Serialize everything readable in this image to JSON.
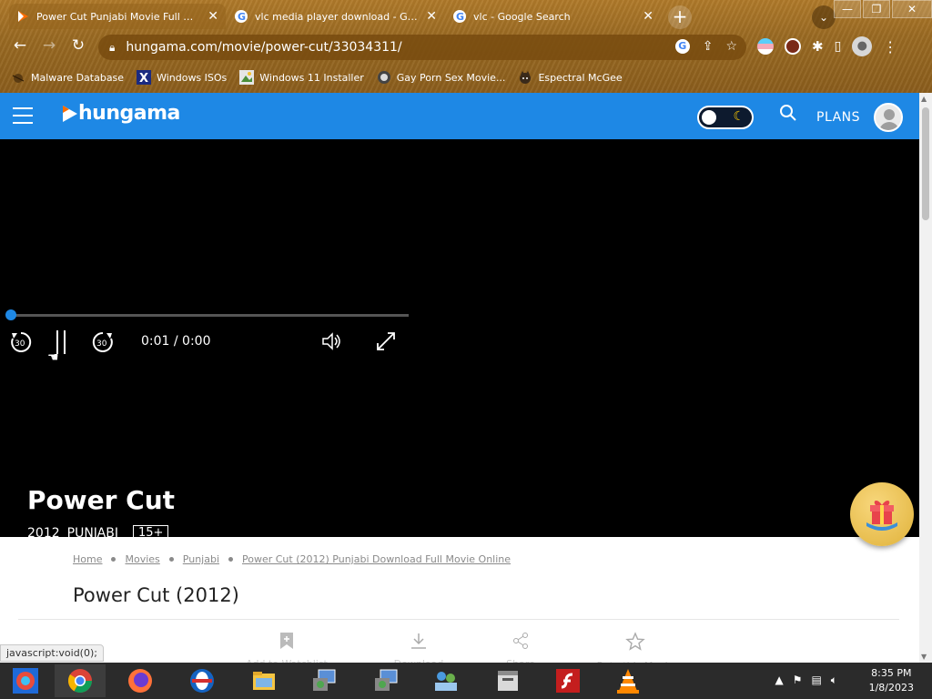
{
  "browser": {
    "tabs": [
      {
        "title": "Power Cut Punjabi Movie Full Download",
        "active": true
      },
      {
        "title": "vlc media player download - Google",
        "active": false
      },
      {
        "title": "vlc - Google Search",
        "active": false
      }
    ],
    "url": "hungama.com/movie/power-cut/33034311/",
    "bookmarks": [
      {
        "label": "Malware Database",
        "icon": "bug-icon"
      },
      {
        "label": "Windows ISOs",
        "icon": "x-logo-icon"
      },
      {
        "label": "Windows 11 Installer",
        "icon": "image-icon"
      },
      {
        "label": "Gay Porn Sex Movie...",
        "icon": "globe-icon"
      },
      {
        "label": "Espectral McGee",
        "icon": "cat-icon"
      }
    ],
    "status_text": "javascript:void(0);"
  },
  "header": {
    "logo_text": "hungama",
    "plans_label": "PLANS",
    "accent": "#1e88e5"
  },
  "player": {
    "time_display": "0:01 / 0:00",
    "skip_back_label": "30",
    "skip_forward_label": "30",
    "progress": 0.0
  },
  "movie": {
    "title": "Power Cut",
    "year": "2012",
    "language": "PUNJABI",
    "rating": "15+"
  },
  "page": {
    "breadcrumb": [
      "Home",
      "Movies",
      "Punjabi",
      "Power Cut (2012) Punjabi Download Full Movie Online"
    ],
    "title": "Power Cut (2012)",
    "actions": [
      {
        "label": "Add to Watchlist",
        "icon": "bookmark-add-icon"
      },
      {
        "label": "Download",
        "icon": "download-icon"
      },
      {
        "label": "Share",
        "icon": "share-icon"
      },
      {
        "label": "Rate this Movie",
        "icon": "star-icon"
      }
    ]
  },
  "taskbar": {
    "apps": [
      "chromium",
      "chrome",
      "firefox",
      "opera",
      "file-explorer",
      "setup",
      "setup-2",
      "network",
      "archive",
      "flash",
      "vlc"
    ],
    "time": "8:35 PM",
    "date": "1/8/2023"
  }
}
